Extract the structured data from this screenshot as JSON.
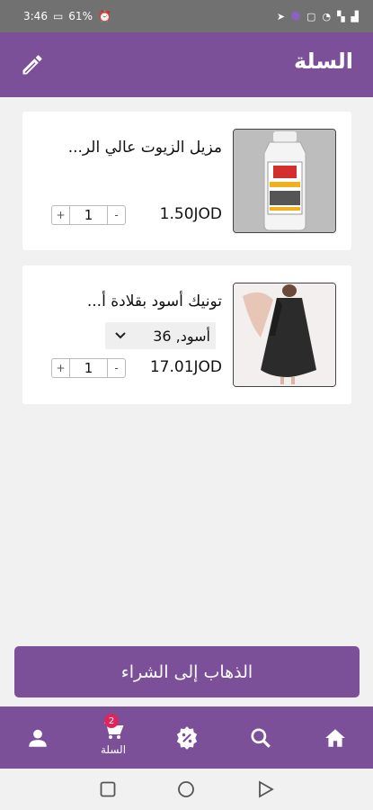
{
  "status": {
    "time": "3:46",
    "battery": "61%"
  },
  "header": {
    "title": "السلة"
  },
  "cart": {
    "items": [
      {
        "name": "مزيل الزيوت عالي الر...",
        "price": "1.50JOD",
        "quantity": "1"
      },
      {
        "name": "تونيك أسود بقلادة أ...",
        "variant": "أسود, 36",
        "price": "17.01JOD",
        "quantity": "1"
      }
    ]
  },
  "checkout": {
    "label": "الذهاب إلى الشراء"
  },
  "bottom_nav": {
    "cart_label": "السلة",
    "cart_badge": "2",
    "items": [
      "profile-icon",
      "cart-icon",
      "offers-icon",
      "search-icon",
      "home-icon"
    ]
  },
  "colors": {
    "primary": "#7c5099",
    "background": "#f1f1f1",
    "badge": "#e0245e"
  }
}
